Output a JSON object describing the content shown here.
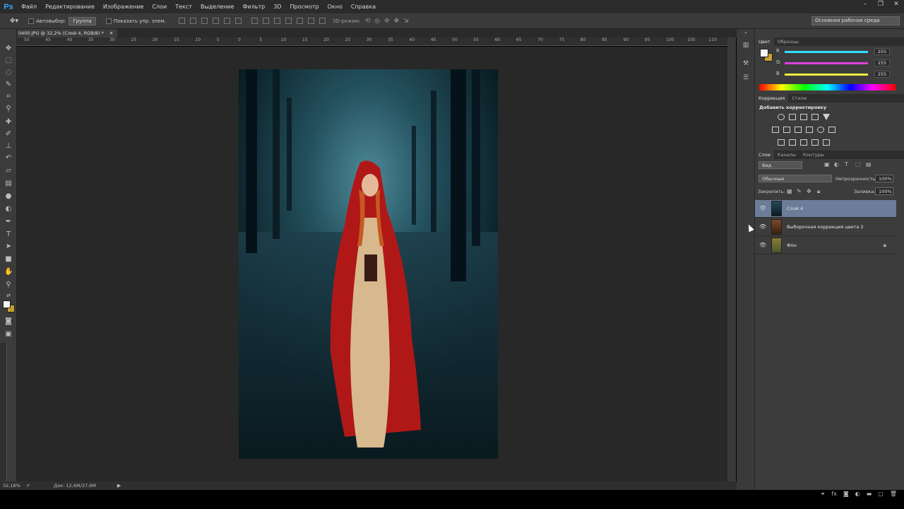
{
  "app": {
    "logo": "Ps"
  },
  "menu": [
    "Файл",
    "Редактирование",
    "Изображение",
    "Слои",
    "Текст",
    "Выделение",
    "Фильтр",
    "3D",
    "Просмотр",
    "Окно",
    "Справка"
  ],
  "options": {
    "autoselect_label": "Автовыбор:",
    "autoselect_value": "Группа",
    "show_controls_label": "Показать упр. элем.",
    "mode_3d_label": "3D-режим:",
    "workspace": "Основная рабочая среда"
  },
  "document": {
    "tab_title": "0400.JPG @ 32,2% (Слой 4, RGB/8) *",
    "zoom": "32,18%",
    "doc_size": "Док: 12,6M/37,9M"
  },
  "ruler_top": [
    "50",
    "45",
    "40",
    "35",
    "30",
    "25",
    "20",
    "15",
    "10",
    "5",
    "0",
    "5",
    "10",
    "15",
    "20",
    "25",
    "30",
    "35",
    "40",
    "45",
    "50",
    "55",
    "60",
    "65",
    "70",
    "75",
    "80",
    "85",
    "90",
    "95",
    "100",
    "105",
    "110"
  ],
  "color_panel": {
    "tabs": [
      "Цвет",
      "Образцы"
    ],
    "channels": [
      {
        "label": "R",
        "value": "255",
        "color": "#30e0ff"
      },
      {
        "label": "G",
        "value": "255",
        "color": "#e040e0"
      },
      {
        "label": "B",
        "value": "255",
        "color": "#f0f040"
      }
    ],
    "foreground": "#f4f4f4",
    "background": "#c8a02c"
  },
  "adjustments_panel": {
    "tabs": [
      "Коррекция",
      "Стили"
    ],
    "title": "Добавить корректировку"
  },
  "layers_panel": {
    "tabs": [
      "Слои",
      "Каналы",
      "Контуры"
    ],
    "kind_filter": "Вид",
    "blend_mode": "Обычные",
    "opacity_label": "Непрозрачность:",
    "opacity_value": "100%",
    "lock_label": "Закрепить:",
    "fill_label": "Заливка:",
    "fill_value": "100%",
    "layers": [
      {
        "name": "Слой 4",
        "selected": true,
        "locked": false
      },
      {
        "name": "Выборочная коррекция цвета 2",
        "selected": false,
        "locked": false
      },
      {
        "name": "Фон",
        "selected": false,
        "locked": true
      }
    ]
  }
}
